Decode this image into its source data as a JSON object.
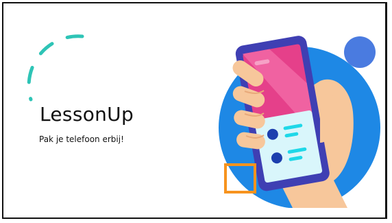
{
  "slide": {
    "title": "LessonUp",
    "subtitle": "Pak je telefoon erbij!"
  },
  "colors": {
    "arc": "#2ec4b6",
    "circle": "#1e88e5",
    "accent_circle": "#4a7be0",
    "phone_body": "#3f3fb3",
    "screen_top": "#e5408a",
    "screen_bottom": "#d9f6fb",
    "dots": "#1c3fae",
    "lines": "#1ed8e8",
    "skin": "#f7c79b",
    "focus": "#f7931e"
  },
  "illustration": {
    "icon": "phone-in-hand-icon"
  }
}
